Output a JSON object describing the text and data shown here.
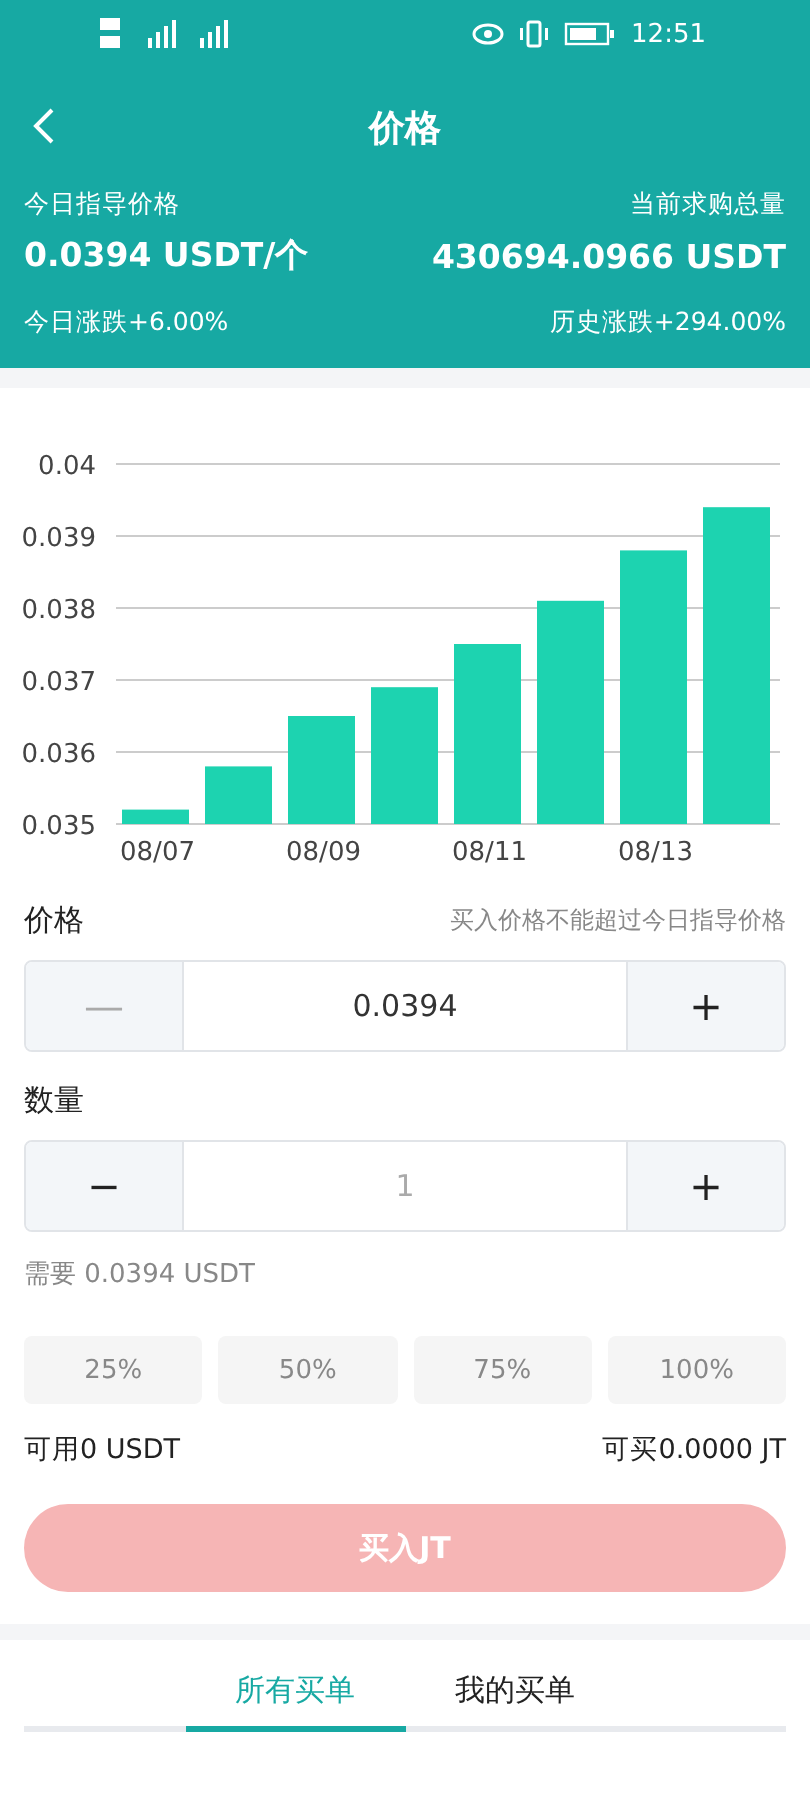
{
  "status_bar": {
    "time": "12:51"
  },
  "header": {
    "title": "价格"
  },
  "summary": {
    "guide_price_label": "今日指导价格",
    "guide_price": "0.0394 USDT/个",
    "total_label": "当前求购总量",
    "total": "430694.0966 USDT",
    "today_change": "今日涨跌+6.00%",
    "history_change": "历史涨跌+294.00%"
  },
  "chart_data": {
    "type": "bar",
    "grid": true,
    "categories": [
      "08/07",
      null,
      "08/09",
      null,
      "08/11",
      null,
      "08/13",
      null
    ],
    "ylim": [
      0.035,
      0.04
    ],
    "yticks": [
      {
        "value": 0.035,
        "label": "0.035"
      },
      {
        "value": 0.036,
        "label": "0.036"
      },
      {
        "value": 0.037,
        "label": "0.037"
      },
      {
        "value": 0.038,
        "label": "0.038"
      },
      {
        "value": 0.039,
        "label": "0.039"
      },
      {
        "value": 0.04,
        "label": "0.04"
      }
    ],
    "series": [
      {
        "color": "#1dd3b0",
        "values": [
          0.0352,
          0.0358,
          0.0365,
          0.0369,
          0.0375,
          0.0381,
          0.0388,
          0.0394
        ]
      }
    ]
  },
  "price": {
    "label": "价格",
    "hint": "买入价格不能超过今日指导价格",
    "minus": "—",
    "value": "0.0394",
    "plus": "+",
    "minus_disabled": true
  },
  "quantity": {
    "label": "数量",
    "minus": "−",
    "placeholder": "1",
    "plus": "+",
    "minus_disabled": false
  },
  "required": "需要 0.0394 USDT",
  "percent_buttons": [
    "25%",
    "50%",
    "75%",
    "100%"
  ],
  "available": "可用0 USDT",
  "can_buy": "可买0.0000 JT",
  "buy_button": {
    "label": "买入JT",
    "disabled": true
  },
  "tabs": [
    {
      "label": "所有买单",
      "selected": true
    },
    {
      "label": "我的买单",
      "selected": false
    }
  ]
}
